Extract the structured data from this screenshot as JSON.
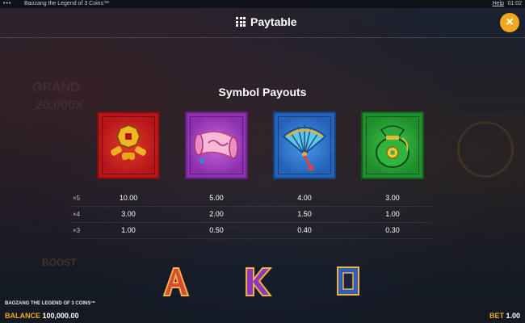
{
  "topbar": {
    "menu_dots": "•••",
    "game_title": "Baozang the Legend of 3 Coins™",
    "help_label": "Help",
    "clock": "01:02"
  },
  "header": {
    "title": "Paytable",
    "close_glyph": "×",
    "grid_icon": "grid-icon"
  },
  "background": {
    "grand_label": "GRAND",
    "grand_amount": "20,000X",
    "boost_label": "BOOST"
  },
  "payouts": {
    "section_title": "Symbol Payouts",
    "symbols": [
      {
        "name": "firecrackers-coin-icon",
        "color": "#c81e1e"
      },
      {
        "name": "scroll-icon",
        "color": "#a140c4"
      },
      {
        "name": "fan-icon",
        "color": "#2e73cc"
      },
      {
        "name": "money-bag-icon",
        "color": "#28a035"
      }
    ],
    "rows": [
      {
        "mult": "×5",
        "values": [
          "10.00",
          "5.00",
          "4.00",
          "3.00"
        ]
      },
      {
        "mult": "×4",
        "values": [
          "3.00",
          "2.00",
          "1.50",
          "1.00"
        ]
      },
      {
        "mult": "×3",
        "values": [
          "1.00",
          "0.50",
          "0.40",
          "0.30"
        ]
      }
    ]
  },
  "letters": [
    "A",
    "K",
    "Q"
  ],
  "footer": {
    "game_name": "BAOZANG THE LEGEND OF 3 COINS™",
    "balance_label": "BALANCE",
    "balance_value": "100,000.00",
    "bet_label": "BET",
    "bet_value": "1.00"
  },
  "colors": {
    "accent": "#f0a91e",
    "background": "#1a1f2b"
  }
}
